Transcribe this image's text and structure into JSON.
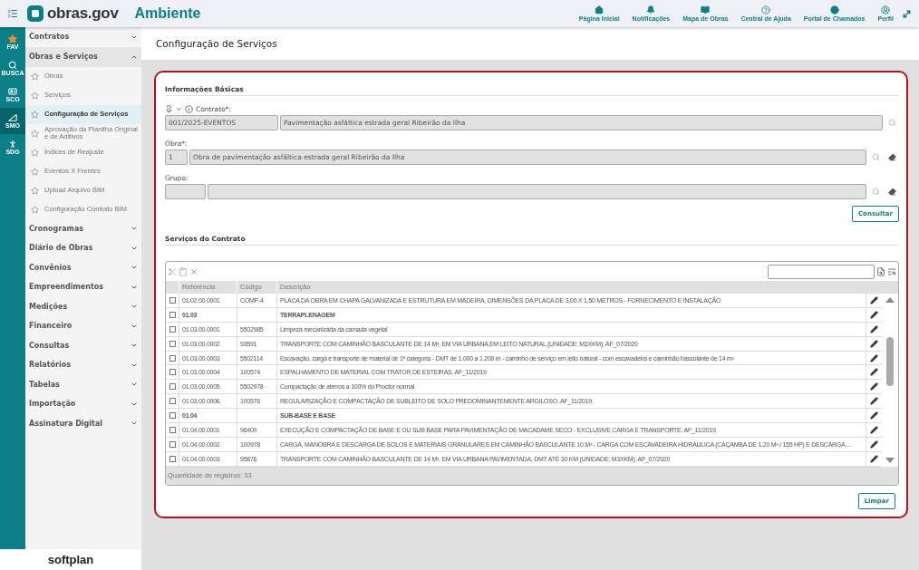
{
  "top_bar": {
    "logo_text": "obras.gov",
    "environment": "Ambiente",
    "nav": [
      {
        "label": "Página Inicial",
        "kind": "home"
      },
      {
        "label": "Notificações",
        "kind": "bell"
      },
      {
        "label": "Mapa de Obras",
        "kind": "map"
      },
      {
        "label": "Central de Ajuda",
        "kind": "help"
      },
      {
        "label": "Portal de Chamados",
        "kind": "support"
      },
      {
        "label": "Perfil",
        "kind": "user"
      }
    ]
  },
  "rail": [
    {
      "label": "FAV",
      "kind": "star",
      "selected": false
    },
    {
      "label": "BUSCA",
      "kind": "search",
      "selected": false
    },
    {
      "label": "SCO",
      "kind": "card",
      "selected": false
    },
    {
      "label": "SMO",
      "kind": "ruler",
      "selected": true
    },
    {
      "label": "SDG",
      "kind": "person",
      "selected": false
    }
  ],
  "sidebar": [
    {
      "label": "Contratos",
      "expanded": false
    },
    {
      "label": "Obras e Serviços",
      "expanded": true,
      "children": [
        {
          "label": "Obras",
          "selected": false
        },
        {
          "label": "Serviços",
          "selected": false
        },
        {
          "label": "Configuração de Serviços",
          "selected": true
        },
        {
          "label": "Aprovação da Planilha Original e de Aditivos",
          "selected": false
        },
        {
          "label": "Índices de Reajuste",
          "selected": false
        },
        {
          "label": "Eventos X Frentes",
          "selected": false
        },
        {
          "label": "Upload Arquivo BIM",
          "selected": false
        },
        {
          "label": "Configuração Contrato BIM",
          "selected": false
        }
      ]
    },
    {
      "label": "Cronogramas",
      "expanded": false
    },
    {
      "label": "Diário de Obras",
      "expanded": false
    },
    {
      "label": "Convênios",
      "expanded": false
    },
    {
      "label": "Empreendimentos",
      "expanded": false
    },
    {
      "label": "Medições",
      "expanded": false
    },
    {
      "label": "Financeiro",
      "expanded": false
    },
    {
      "label": "Consultas",
      "expanded": false
    },
    {
      "label": "Relatórios",
      "expanded": false
    },
    {
      "label": "Tabelas",
      "expanded": false
    },
    {
      "label": "Importação",
      "expanded": false
    },
    {
      "label": "Assinatura Digital",
      "expanded": false
    }
  ],
  "brand": "softplan",
  "page_title": "Configuração de Serviços",
  "basic_info": {
    "title": "Informações Básicas",
    "contrato": {
      "label": "Contrato*:",
      "code": "001/2025-EVENTOS",
      "description": "Pavimentação asfáltica estrada geral Ribeirão da Ilha"
    },
    "obra": {
      "label": "Obra*:",
      "code": "1",
      "description": "Obra de pavimentação asfáltica estrada geral Ribeirão da Ilha"
    },
    "grupo": {
      "label": "Grupo:"
    },
    "consult_button": "Consultar"
  },
  "services": {
    "title": "Serviços do Contrato",
    "columns": [
      "Referência",
      "Código",
      "Descrição"
    ],
    "rows": [
      {
        "kind": "item",
        "checked": false,
        "referencia": "01.02.00.0001",
        "codigo": "COMP-4",
        "descricao": "PLACA DA OBRA EM CHAPA GALVANIZADA E ESTRUTURA EM MADEIRA, DIMENSÕES DA PLACA DE 3,00 X 1,50 METROS - FORNECIMENTO E INSTALAÇÃO"
      },
      {
        "kind": "group",
        "checked": false,
        "referencia": "01.03",
        "descricao": "TERRAPLENAGEM"
      },
      {
        "kind": "item",
        "checked": false,
        "referencia": "01.03.00.0001",
        "codigo": "5502985",
        "descricao": "Limpeza mecanizada da camada vegetal"
      },
      {
        "kind": "item",
        "checked": false,
        "referencia": "01.03.00.0002",
        "codigo": "93591",
        "descricao": "TRANSPORTE COM CAMINHÃO BASCULANTE DE 14 M³, EM VIA URBANA EM LEITO NATURAL (UNIDADE: M3XKM). AF_07/2020"
      },
      {
        "kind": "item",
        "checked": false,
        "referencia": "01.03.00.0003",
        "codigo": "5502114",
        "descricao": "Escavação, carga e transporte de material de 1ª categoria - DMT de 1.000 a 1.200 m - caminho de serviço em leito natural - com escavadeira e caminhão basculante de 14 m³"
      },
      {
        "kind": "item",
        "checked": false,
        "referencia": "01.03.00.0004",
        "codigo": "100574",
        "descricao": "ESPALHAMENTO DE MATERIAL COM TRATOR DE ESTEIRAS. AF_11/2019"
      },
      {
        "kind": "item",
        "checked": false,
        "referencia": "01.03.00.0005",
        "codigo": "5502978",
        "descricao": "Compactação de aterros a 100% do Proctor normal"
      },
      {
        "kind": "item",
        "checked": false,
        "referencia": "01.03.00.0006",
        "codigo": "100576",
        "descricao": "REGULARIZAÇÃO E COMPACTAÇÃO DE SUBLEITO DE SOLO PREDOMINANTEMENTE ARGILOSO. AF_11/2019"
      },
      {
        "kind": "group",
        "checked": false,
        "referencia": "01.04",
        "descricao": "SUB-BASE E BASE"
      },
      {
        "kind": "item",
        "checked": false,
        "referencia": "01.04.00.0001",
        "codigo": "96400",
        "descricao": "EXECUÇÃO E COMPACTAÇÃO DE BASE E OU SUB BASE PARA PAVIMENTAÇÃO DE MACADAME SECO - EXCLUSIVE CARGA E TRANSPORTE. AF_11/2019"
      },
      {
        "kind": "item",
        "checked": false,
        "referencia": "01.04.00.0002",
        "codigo": "100978",
        "descricao": "CARGA, MANOBRA E DESCARGA DE SOLOS E MATERIAIS GRANULARES EM CAMINHÃO BASCULANTE 10 M³ - CARGA COM ESCAVADEIRA HIDRÁULICA (CAÇAMBA DE 1,20 M³ / 155 HP) E DESCARGA ..."
      },
      {
        "kind": "item",
        "checked": false,
        "referencia": "01.04.00.0003",
        "codigo": "95876",
        "descricao": "TRANSPORTE COM CAMINHÃO BASCULANTE DE 14 M³, EM VIA URBANA PAVIMENTADA, DMT ATÉ 30 KM (UNIDADE: M3XKM). AF_07/2020"
      }
    ],
    "record_count": "Quantidade de registros: 33",
    "clear_button": "Limpar"
  }
}
